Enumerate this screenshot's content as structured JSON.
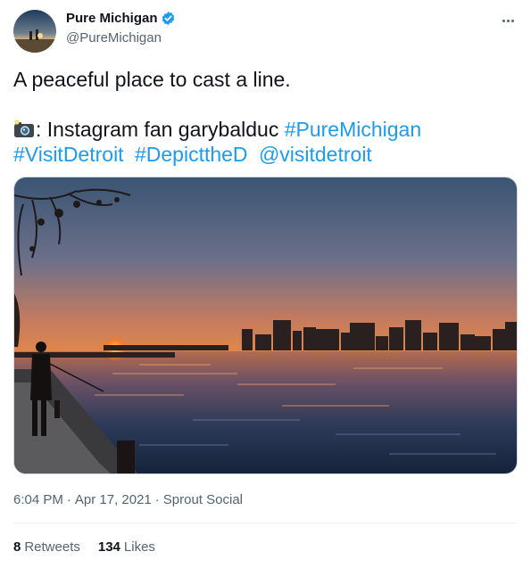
{
  "account": {
    "display_name": "Pure Michigan",
    "handle": "@PureMichigan",
    "verified": true
  },
  "icons": {
    "verified": "verified-badge-icon",
    "more": "more-options-icon",
    "camera": "camera-flash-emoji"
  },
  "tweet": {
    "text_line1": "A peaceful place to cast a line.",
    "credit_prefix": ": Instagram fan garybalduc ",
    "hashtags": [
      "#PureMichigan",
      "#VisitDetroit",
      "#DepicttheD"
    ],
    "mention": "@visitdetroit"
  },
  "meta": {
    "time": "6:04 PM",
    "separator": "·",
    "date": "Apr 17, 2021",
    "source": "Sprout Social"
  },
  "stats": {
    "retweets_count": "8",
    "retweets_label": "Retweets",
    "likes_count": "134",
    "likes_label": "Likes"
  },
  "colors": {
    "link": "#1d9bf0",
    "verified": "#1d9bf0",
    "text": "#0f1419",
    "secondary": "#536471",
    "divider": "#eff3f4"
  }
}
